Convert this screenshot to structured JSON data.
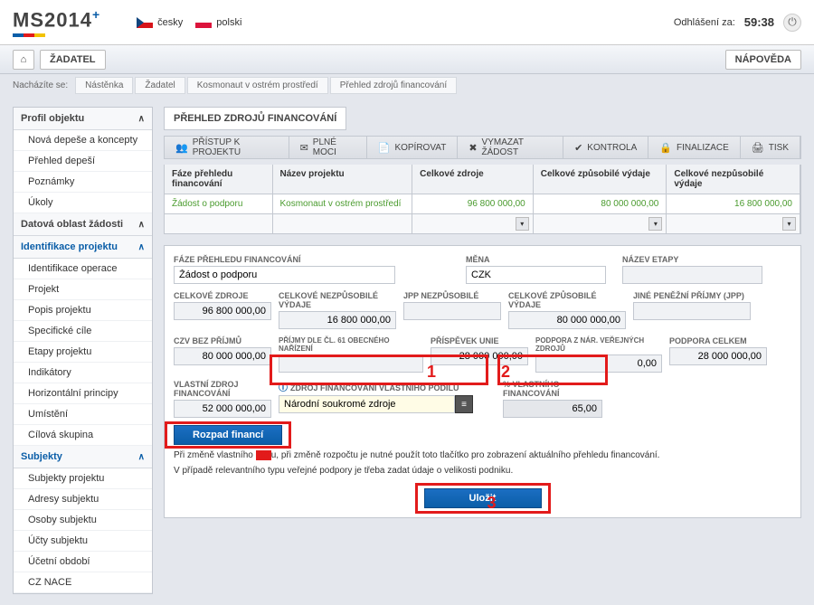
{
  "header": {
    "logo_main": "MS2014",
    "logo_plus": "+",
    "lang_cz": "česky",
    "lang_pl": "polski",
    "logout_label": "Odhlášení za:",
    "logout_timer": "59:38"
  },
  "menu": {
    "zadatel": "ŽADATEL",
    "napoveda": "NÁPOVĚDA"
  },
  "breadcrumb": {
    "label": "Nacházíte se:",
    "items": [
      "Nástěnka",
      "Žadatel",
      "Kosmonaut v ostrém prostředí",
      "Přehled zdrojů financování"
    ]
  },
  "sidebar": {
    "g0": "Profil objektu",
    "i0": "Nová depeše a koncepty",
    "i1": "Přehled depeší",
    "i2": "Poznámky",
    "i3": "Úkoly",
    "g1": "Datová oblast žádosti",
    "g2": "Identifikace projektu",
    "i4": "Identifikace operace",
    "i5": "Projekt",
    "i6": "Popis projektu",
    "i7": "Specifické cíle",
    "i8": "Etapy projektu",
    "i9": "Indikátory",
    "i10": "Horizontální principy",
    "i11": "Umístění",
    "i12": "Cílová skupina",
    "g3": "Subjekty",
    "i13": "Subjekty projektu",
    "i14": "Adresy subjektu",
    "i15": "Osoby subjektu",
    "i16": "Účty subjektu",
    "i17": "Účetní období",
    "i18": "CZ NACE"
  },
  "panel_title": "PŘEHLED ZDROJŮ FINANCOVÁNÍ",
  "toolbar": {
    "b0": "PŘÍSTUP K PROJEKTU",
    "b1": "PLNÉ MOCI",
    "b2": "KOPÍROVAT",
    "b3": "VYMAZAT ŽÁDOST",
    "b4": "KONTROLA",
    "b5": "FINALIZACE",
    "b6": "TISK"
  },
  "grid": {
    "h0": "Fáze přehledu financování",
    "h1": "Název projektu",
    "h2": "Celkové zdroje",
    "h3": "Celkové způsobilé výdaje",
    "h4": "Celkové nezpůsobilé výdaje",
    "r0c0": "Žádost o podporu",
    "r0c1": "Kosmonaut v ostrém prostředí",
    "r0c2": "96 800 000,00",
    "r0c3": "80 000 000,00",
    "r0c4": "16 800 000,00"
  },
  "form": {
    "l_faze": "FÁZE PŘEHLEDU FINANCOVÁNÍ",
    "v_faze": "Žádost o podporu",
    "l_mena": "MĚNA",
    "v_mena": "CZK",
    "l_etapa": "NÁZEV ETAPY",
    "v_etapa": "",
    "l_celkzdr": "CELKOVÉ ZDROJE",
    "v_celkzdr": "96 800 000,00",
    "l_celknez": "CELKOVÉ NEZPŮSOBILÉ VÝDAJE",
    "v_celknez": "16 800 000,00",
    "l_jppnez": "JPP NEZPŮSOBILÉ",
    "v_jppnez": "",
    "l_celkzpu": "CELKOVÉ ZPŮSOBILÉ VÝDAJE",
    "v_celkzpu": "80 000 000,00",
    "l_jpp": "JINÉ PENĚŽNÍ PŘÍJMY (JPP)",
    "v_jpp": "",
    "l_czvbez": "CZV BEZ PŘÍJMŮ",
    "v_czvbez": "80 000 000,00",
    "l_prijmy61": "PŘÍJMY DLE ČL. 61 OBECNÉHO NAŘÍZENÍ",
    "v_prijmy61": "",
    "l_prispunie": "PŘÍSPĚVEK UNIE",
    "v_prispunie": "28 000 000,00",
    "l_podporanar": "PODPORA Z NÁR. VEŘEJNÝCH ZDROJŮ",
    "v_podporanar": "0,00",
    "l_podporacelk": "PODPORA CELKEM",
    "v_podporacelk": "28 000 000,00",
    "l_vlastni": "VLASTNÍ ZDROJ FINANCOVÁNÍ",
    "v_vlastni": "52 000 000,00",
    "l_zdrojvlast": "ZDROJ FINANCOVÁNÍ VLASTNÍHO PODÍLU",
    "v_zdrojvlast": "Národní soukromé zdroje",
    "l_pctvlast": "% VLASTNÍHO FINANCOVÁNÍ",
    "v_pctvlast": "65,00"
  },
  "buttons": {
    "rozpad": "Rozpad financí",
    "ulozit": "Uložit"
  },
  "notes": {
    "n1_a": "Při změně vlastního ",
    "n1_b": "u, při změně rozpočtu je nutné použít toto tlačítko pro zobrazení aktuálního přehledu financování.",
    "n2": "V případě relevantního typu veřejné podpory je třeba zadat údaje o velikosti podniku."
  },
  "annotations": {
    "a1": "1",
    "a2": "2",
    "a3": "3"
  }
}
